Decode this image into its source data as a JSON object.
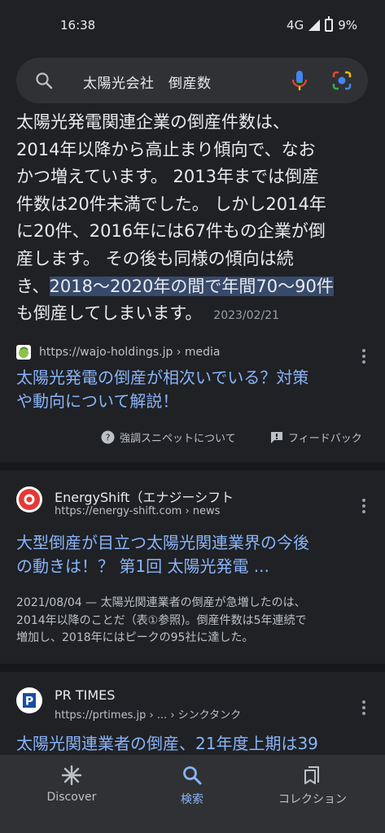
{
  "status": {
    "time": "16:38",
    "network": "4G",
    "battery": "9%"
  },
  "search": {
    "query": "太陽光会社　倒産数"
  },
  "featured": {
    "lines": [
      "太陽光発電関連企業の倒産件数は、",
      "2014年以降から高止まり傾向で、なお",
      "かつ増えています。 2013年までは倒産",
      "件数は20件未満でした。 しかし2014年",
      "に20件、2016年には67件もの企業が倒",
      "産します。 その後も同様の傾向は続"
    ],
    "line7_pre": "き、",
    "highlight": "2018〜2020年の間で年間70〜90件",
    "line8": "も倒産してしまいます。",
    "date": "2023/02/21",
    "source_url": "https://wajo-holdings.jp › media",
    "title_line1": "太陽光発電の倒産が相次いでいる？対策",
    "title_line2": "や動向について解説！",
    "about_label": "強調スニペットについて",
    "feedback_label": "フィードバック"
  },
  "results": [
    {
      "site": "EnergyShift（エナジーシフト",
      "url": "https://energy-shift.com › news",
      "title_line1": "大型倒産が目立つ太陽光関連業界の今後",
      "title_line2": "の動きは！？ 第1回 太陽光発電 ...",
      "desc_line1": "2021/08/04 — 太陽光関連業者の倒産が急増したのは、",
      "desc_line2": "2014年以降のことだ（表①参照)。倒産件数は5年連続で",
      "desc_line3": "増加し、2018年にはピークの95社に達した。"
    },
    {
      "site": "PR TIMES",
      "url": "https://prtimes.jp › ... › シンクタンク",
      "title_line1": "太陽光関連業者の倒産、21年度上期は39"
    }
  ],
  "nav": {
    "discover": "Discover",
    "search": "検索",
    "collections": "コレクション"
  },
  "colors": {
    "background": "#1f2125",
    "link": "#8ab4f8",
    "highlight": "#384a6b",
    "surface": "#303134"
  }
}
